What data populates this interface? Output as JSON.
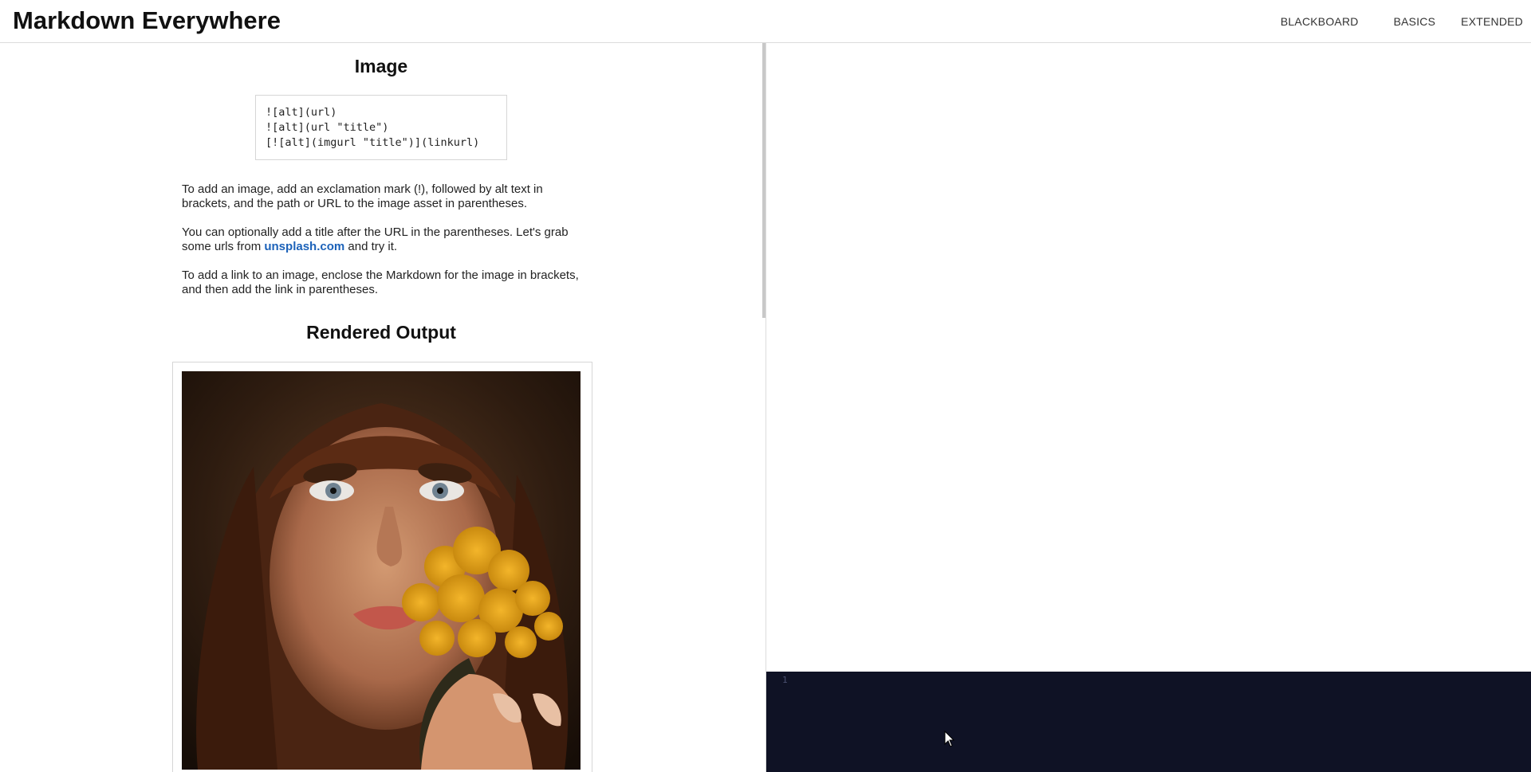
{
  "header": {
    "title": "Markdown Everywhere",
    "nav": {
      "blackboard": "BLACKBOARD",
      "basics": "BASICS",
      "extended": "EXTENDED"
    }
  },
  "lesson": {
    "title": "Image",
    "code_lines": [
      "![alt](url)",
      "![alt](url \"title\")",
      "[![alt](imgurl \"title\")](linkurl)"
    ],
    "paragraphs": {
      "p1": "To add an image, add an exclamation mark (!), followed by alt text in brackets, and the path or URL to the image asset in parentheses.",
      "p2_before": "You can optionally add a title after the URL in the parentheses. Let's grab some urls from ",
      "p2_link": "unsplash.com",
      "p2_after": " and try it.",
      "p3": "To add a link to an image, enclose the Markdown for the image in brackets, and then add the link in parentheses."
    },
    "output_title": "Rendered Output"
  },
  "editor": {
    "line_number": "1",
    "background": "#0f1225"
  },
  "colors": {
    "link": "#1c62b9",
    "divider": "#dcdcdc"
  },
  "icons": {
    "pointer": "mouse-pointer-icon"
  }
}
